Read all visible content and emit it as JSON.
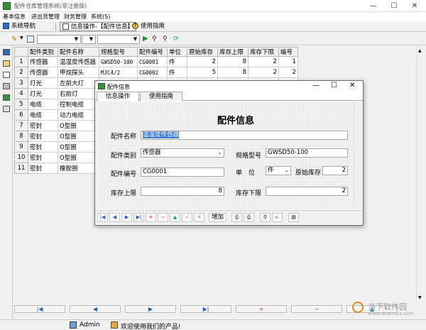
{
  "window": {
    "title": "配件仓库管理系统(非注册版)",
    "minimize": "—",
    "maximize": "☐",
    "close": "✕"
  },
  "menu": [
    "基本信息",
    "进出货管理",
    "财务管理",
    "系统(S)"
  ],
  "toolbar1": {
    "nav_label": "系统导航",
    "info_label": "信息操作-【配件信息】",
    "help_label": "使用指南"
  },
  "grid": {
    "headers": [
      "配件类别",
      "配件名称",
      "规格型号",
      "配件编号",
      "单位",
      "原始库存",
      "库存上限",
      "库存下限",
      "编号"
    ],
    "rows": [
      [
        "1",
        "传感器",
        "温湿度传感器",
        "GWSD50-100",
        "CG0001",
        "件",
        "2",
        "8",
        "2",
        "1"
      ],
      [
        "2",
        "传感器",
        "甲烷探头",
        "MJC4/2",
        "CG0002",
        "件",
        "5",
        "8",
        "2",
        "2"
      ],
      [
        "3",
        "灯光",
        "左前大灯",
        "",
        "",
        "",
        "",
        "",
        "",
        ""
      ],
      [
        "4",
        "灯光",
        "右前灯",
        "",
        "",
        "",
        "",
        "",
        "",
        ""
      ],
      [
        "5",
        "电缆",
        "控制电缆",
        "",
        "",
        "",
        "",
        "",
        "",
        ""
      ],
      [
        "6",
        "电缆",
        "动力电缆",
        "",
        "",
        "",
        "",
        "",
        "",
        ""
      ],
      [
        "7",
        "密封",
        "O型圈",
        "",
        "",
        "",
        "",
        "",
        "",
        ""
      ],
      [
        "8",
        "密封",
        "O型圈",
        "",
        "",
        "",
        "",
        "",
        "",
        ""
      ],
      [
        "9",
        "密封",
        "O型圈",
        "",
        "",
        "",
        "",
        "",
        "",
        ""
      ],
      [
        "10",
        "密封",
        "O型圈",
        "",
        "",
        "",
        "",
        "",
        "",
        ""
      ],
      [
        "11",
        "密封",
        "橡胶圈",
        "",
        "",
        "",
        "",
        "",
        "",
        ""
      ]
    ]
  },
  "status": {
    "user": "Admin",
    "welcome": "欢迎使用我们的产品!"
  },
  "dialog": {
    "title": "配件信息",
    "tabs": [
      "信息操作",
      "使用指南"
    ],
    "heading": "配件信息",
    "labels": {
      "name": "配件名称",
      "category": "配件类别",
      "spec": "规格型号",
      "code": "配件编号",
      "unit": "单　位",
      "initial": "原始库存",
      "upper": "库存上限",
      "lower": "库存下限"
    },
    "values": {
      "name": "温湿度传感器",
      "category": "传感器",
      "spec": "GWSD50-100",
      "code": "CG0001",
      "unit": "件",
      "initial": "2",
      "upper": "8",
      "lower": "2"
    },
    "add_button": "增加"
  },
  "watermark": {
    "text1": "当下软件园",
    "text2": "www.downxia.com"
  },
  "colors": {
    "accent": "#3b7bd6",
    "nav_blue": "#1f5fbf",
    "red": "#d03020"
  }
}
